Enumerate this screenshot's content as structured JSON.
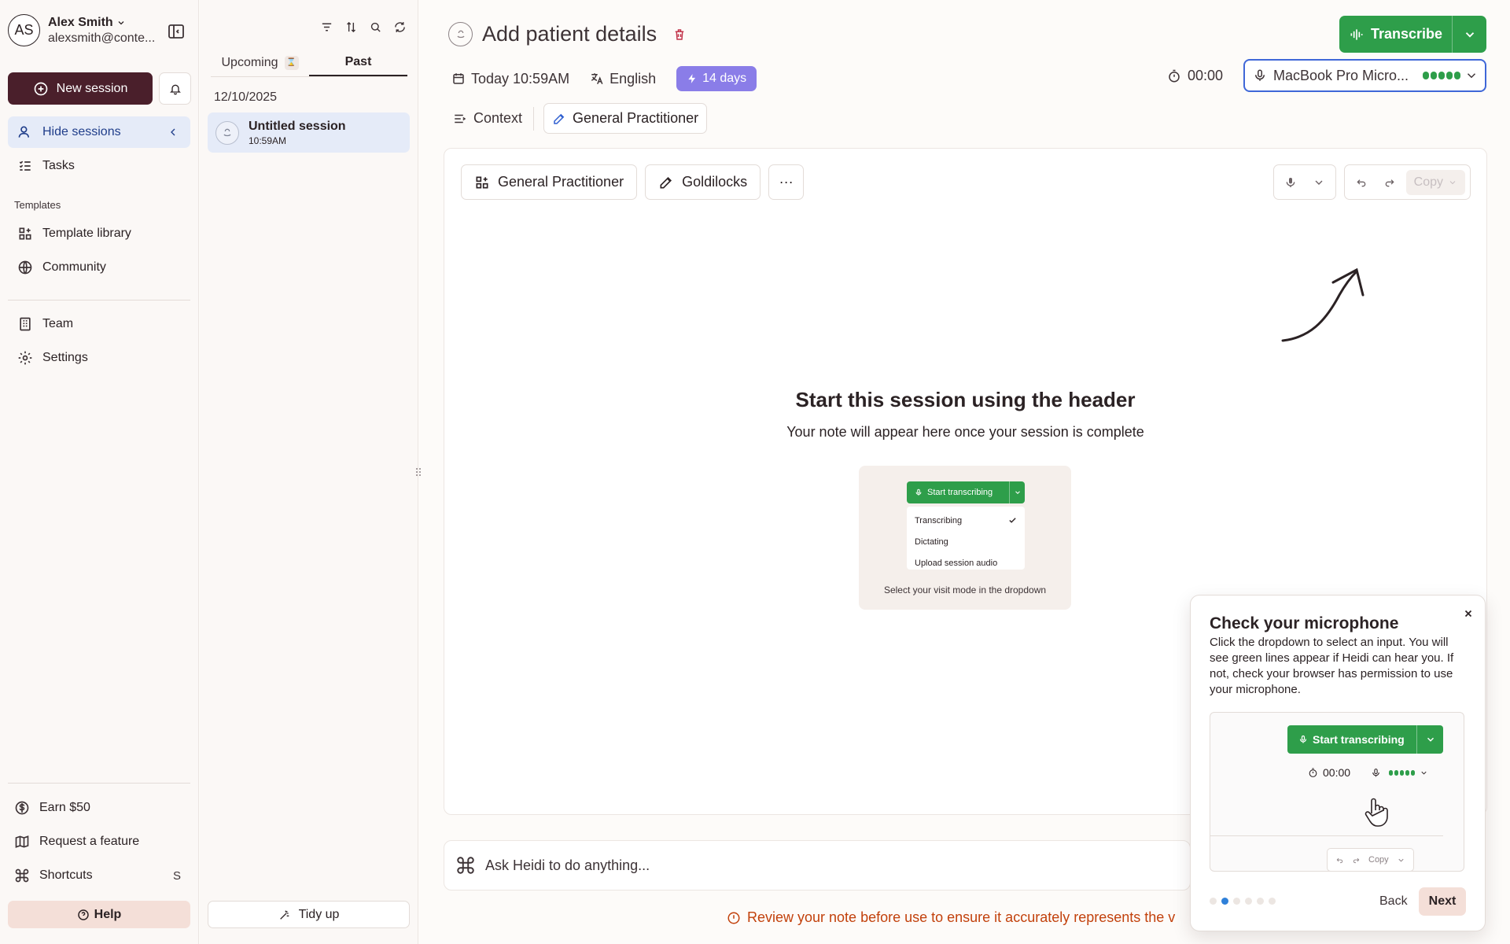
{
  "user": {
    "initials": "AS",
    "name": "Alex Smith",
    "email": "alexsmith@conte..."
  },
  "sidebar": {
    "new_session": "New session",
    "hide_sessions": "Hide sessions",
    "tasks": "Tasks",
    "templates_section": "Templates",
    "template_library": "Template library",
    "community": "Community",
    "team": "Team",
    "settings": "Settings",
    "earn": "Earn $50",
    "request_feature": "Request a feature",
    "shortcuts": "Shortcuts",
    "shortcuts_key": "S",
    "help": "Help"
  },
  "sessions": {
    "tabs": [
      {
        "label": "Upcoming",
        "badge": "ⅹ"
      },
      {
        "label": "Past"
      }
    ],
    "date": "12/10/2025",
    "items": [
      {
        "title": "Untitled session",
        "time": "10:59AM"
      }
    ],
    "tidy_up": "Tidy up"
  },
  "header": {
    "title": "Add patient details",
    "date_time": "Today 10:59AM",
    "language": "English",
    "days": "14 days",
    "timer": "00:00",
    "transcribe": "Transcribe",
    "mic_device": "MacBook Pro Micro...",
    "context_tab": "Context",
    "template_tab": "General Practitioner"
  },
  "note": {
    "template_btn": "General Practitioner",
    "style_btn": "Goldilocks",
    "more_btn": "···",
    "copy": "Copy",
    "empty_title": "Start this session using the header",
    "empty_sub": "Your note will appear here once your session is complete",
    "illus": {
      "button": "Start transcribing",
      "options": [
        "Transcribing",
        "Dictating",
        "Upload session audio"
      ],
      "caption": "Select your visit mode in the dropdown"
    }
  },
  "ask": {
    "placeholder": "Ask Heidi to do anything..."
  },
  "review_note": "Review your note before use to ensure it accurately represents the v",
  "popover": {
    "title": "Check your microphone",
    "body": "Click the dropdown to select an input. You will see green lines appear if Heidi can hear you. If not, check your browser has permission to use your microphone.",
    "illus_button": "Start transcribing",
    "illus_timer": "00:00",
    "illus_copy": "Copy",
    "back": "Back",
    "next": "Next",
    "step": 2,
    "steps": 6
  },
  "colors": {
    "brand": "#4a1f2b",
    "green": "#2e9e4a",
    "accent_blue": "#3f67d8",
    "days_purple": "#8a7de8",
    "warning": "#c2410c",
    "help_bg": "#f4dfd8"
  }
}
